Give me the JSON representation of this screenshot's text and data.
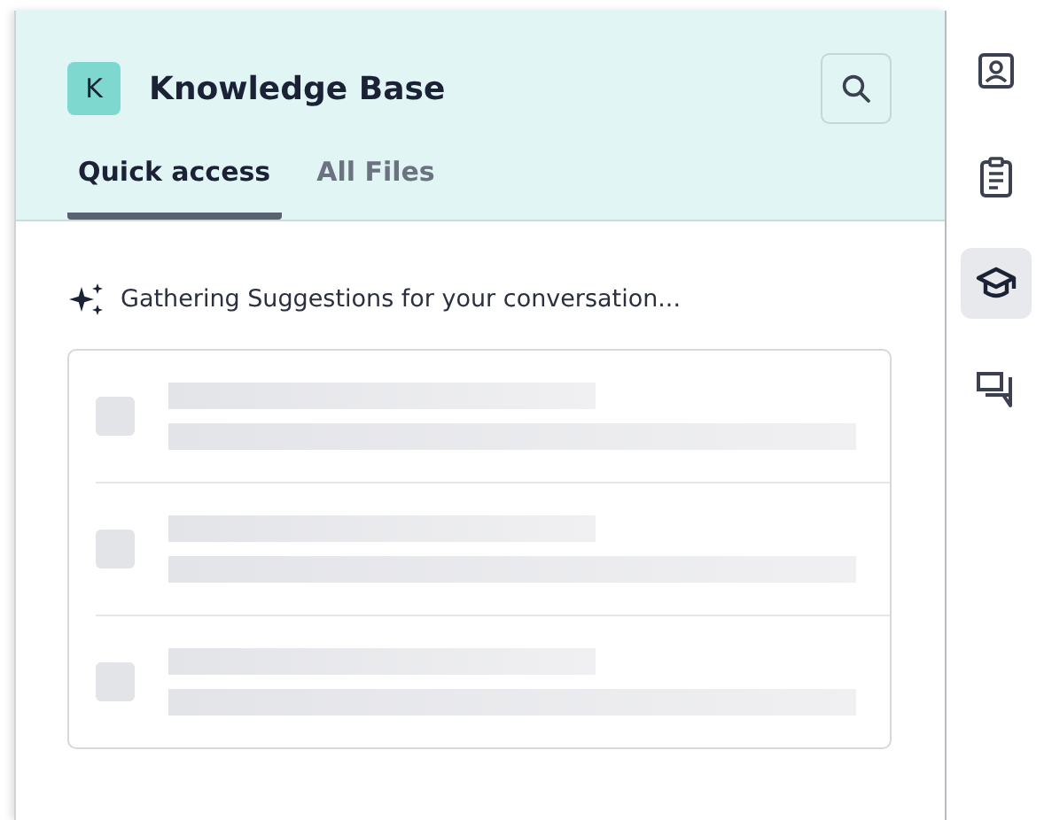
{
  "header": {
    "logo_letter": "K",
    "title": "Knowledge Base"
  },
  "tabs": [
    {
      "label": "Quick access",
      "selected": true
    },
    {
      "label": "All Files",
      "selected": false
    }
  ],
  "status": {
    "text": "Gathering Suggestions for your conversation...",
    "loading": true
  },
  "rail": [
    {
      "kind": "contact",
      "selected": false
    },
    {
      "kind": "clipboard",
      "selected": false
    },
    {
      "kind": "graduation",
      "selected": true
    },
    {
      "kind": "chat",
      "selected": false
    }
  ]
}
